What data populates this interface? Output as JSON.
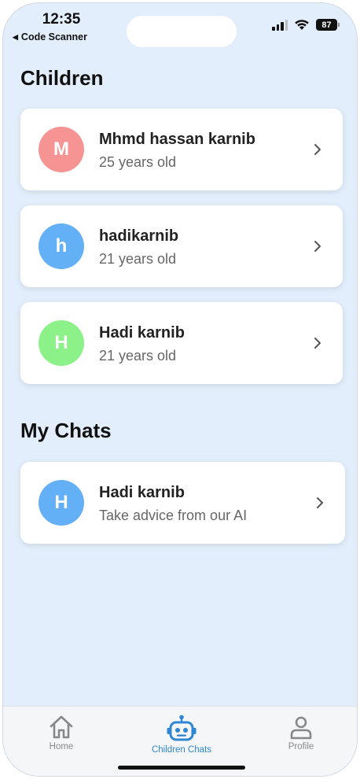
{
  "status_bar": {
    "time": "12:35",
    "back_label": "Code Scanner",
    "battery": "87"
  },
  "sections": {
    "children_title": "Children",
    "chats_title": "My Chats"
  },
  "children": [
    {
      "initial": "M",
      "name": "Mhmd hassan karnib",
      "age": "25 years old",
      "color": "#f69494"
    },
    {
      "initial": "h",
      "name": "hadikarnib",
      "age": "21 years old",
      "color": "#64b0f6"
    },
    {
      "initial": "H",
      "name": "Hadi karnib",
      "age": "21 years old",
      "color": "#8bf188"
    }
  ],
  "chats": [
    {
      "initial": "H",
      "name": "Hadi karnib",
      "subtitle": "Take advice from our AI",
      "color": "#64b0f6"
    }
  ],
  "tabbar": {
    "tabs": [
      {
        "label": "Home",
        "icon": "home-icon"
      },
      {
        "label": "Children Chats",
        "icon": "robot-icon",
        "active": true
      },
      {
        "label": "Profile",
        "icon": "person-icon"
      }
    ],
    "active_color": "#2f86d3",
    "inactive_color": "#888888"
  }
}
